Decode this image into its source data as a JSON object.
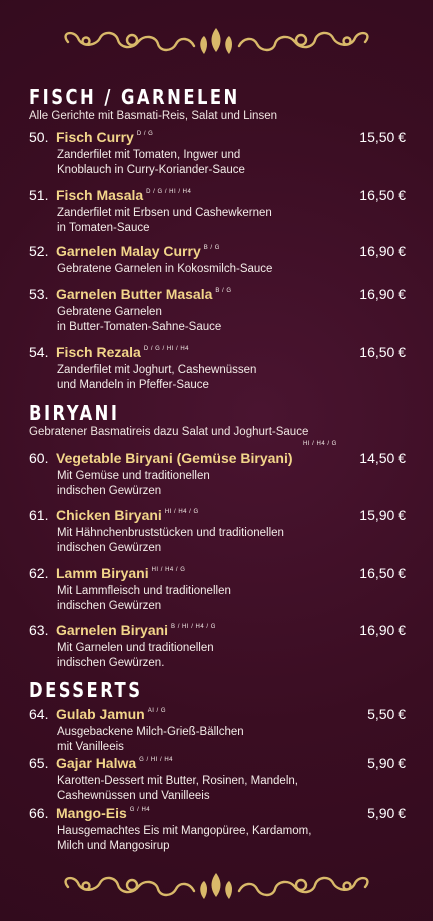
{
  "ornament": {
    "color": "#d9b96a",
    "icon": "scroll-ornament-icon"
  },
  "sections": {
    "fisch": {
      "title": "FISCH / GARNELEN",
      "subtitle": "Alle Gerichte mit Basmati-Reis, Salat und Linsen",
      "items": [
        {
          "num": "50.",
          "name": "Fisch Curry",
          "codes": "D / G",
          "price": "15,50 €",
          "desc": "Zanderfilet mit Tomaten, Ingwer und\nKnoblauch in Curry-Koriander-Sauce"
        },
        {
          "num": "51.",
          "name": "Fisch Masala",
          "codes": "D / G / HI / H4",
          "price": "16,50 €",
          "desc": "Zanderfilet mit Erbsen und Cashewkernen\nin Tomaten-Sauce"
        },
        {
          "num": "52.",
          "name": "Garnelen Malay Curry",
          "codes": "B / G",
          "price": "16,90 €",
          "desc": "Gebratene Garnelen in Kokosmilch-Sauce"
        },
        {
          "num": "53.",
          "name": "Garnelen Butter Masala",
          "codes": "B / G",
          "price": "16,90 €",
          "desc": "Gebratene Garnelen\nin Butter-Tomaten-Sahne-Sauce"
        },
        {
          "num": "54.",
          "name": "Fisch Rezala",
          "codes": "D / G / HI / H4",
          "price": "16,50 €",
          "desc": "Zanderfilet mit Joghurt, Cashewnüssen\nund Mandeln in Pfeffer-Sauce"
        }
      ]
    },
    "biryani": {
      "title": "BIRYANI",
      "subtitle": "Gebratener Basmatireis dazu Salat und Joghurt-Sauce",
      "items": [
        {
          "num": "60.",
          "name": "Vegetable Biryani (Gemüse Biryani)",
          "codes": "HI / H4 / G",
          "price": "14,50 €",
          "desc": "Mit Gemüse und traditionellen\nindischen Gewürzen"
        },
        {
          "num": "61.",
          "name": "Chicken Biryani",
          "codes": "HI / H4 / G",
          "price": "15,90 €",
          "desc": "Mit Hähnchenbruststücken und traditionellen\nindischen Gewürzen"
        },
        {
          "num": "62.",
          "name": "Lamm Biryani",
          "codes": "HI / H4 / G",
          "price": "16,50 €",
          "desc": "Mit Lammfleisch und traditionellen\nindischen Gewürzen"
        },
        {
          "num": "63.",
          "name": "Garnelen Biryani",
          "codes": "B / HI / H4 / G",
          "price": "16,90 €",
          "desc": "Mit Garnelen und traditionellen\nindischen Gewürzen."
        }
      ]
    },
    "desserts": {
      "title": "DESSERTS",
      "items": [
        {
          "num": "64.",
          "name": "Gulab Jamun",
          "codes": "AI / G",
          "price": "5,50 €",
          "desc": "Ausgebackene Milch-Grieß-Bällchen\nmit Vanilleeis"
        },
        {
          "num": "65.",
          "name": "Gajar Halwa",
          "codes": "G / HI / H4",
          "price": "5,90 €",
          "desc": "Karotten-Dessert mit Butter, Rosinen, Mandeln,\nCashewnüssen und Vanilleeis"
        },
        {
          "num": "66.",
          "name": "Mango-Eis",
          "codes": "G / H4",
          "price": "5,90 €",
          "desc": "Hausgemachtes Eis mit Mangopüree, Kardamom,\nMilch und Mangosirup"
        }
      ]
    }
  }
}
